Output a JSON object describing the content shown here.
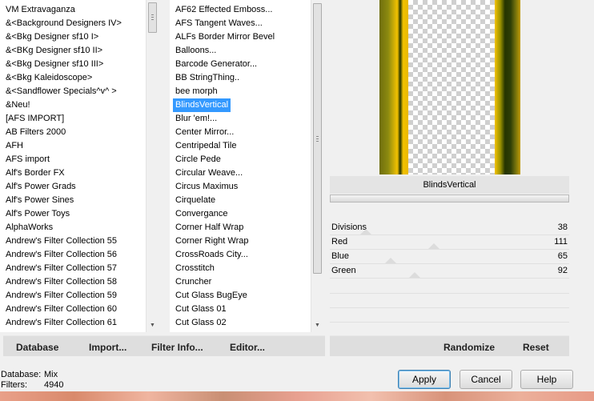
{
  "categories": {
    "items": [
      "VM Extravaganza",
      "&<Background Designers IV>",
      "&<Bkg Designer sf10 I>",
      "&<BKg Designer sf10 II>",
      "&<Bkg Designer sf10 III>",
      "&<Bkg Kaleidoscope>",
      "&<Sandflower Specials^v^ >",
      "&Neu!",
      "[AFS IMPORT]",
      "AB Filters 2000",
      "AFH",
      "AFS import",
      "Alf's Border FX",
      "Alf's Power Grads",
      "Alf's Power Sines",
      "Alf's Power Toys",
      "AlphaWorks",
      "Andrew's Filter Collection 55",
      "Andrew's Filter Collection 56",
      "Andrew's Filter Collection 57",
      "Andrew's Filter Collection 58",
      "Andrew's Filter Collection 59",
      "Andrew's Filter Collection 60",
      "Andrew's Filter Collection 61"
    ]
  },
  "filters": {
    "selected_index": 7,
    "items": [
      "AF62 Effected Emboss...",
      "AFS Tangent Waves...",
      "ALFs Border Mirror Bevel",
      "Balloons...",
      "Barcode Generator...",
      "BB StringThing..",
      "bee morph",
      "BlindsVertical",
      "Blur 'em!...",
      "Center Mirror...",
      "Centripedal Tile",
      "Circle Pede",
      "Circular Weave...",
      "Circus Maximus",
      "Cirquelate",
      "Convergance",
      "Corner Half Wrap",
      "Corner Right Wrap",
      "CrossRoads City...",
      "Crosstitch",
      "Cruncher",
      "Cut Glass  BugEye",
      "Cut Glass 01",
      "Cut Glass 02"
    ]
  },
  "preview": {
    "filter_name": "BlindsVertical",
    "stripe_colors": [
      "#6f6e0d",
      "#f3c200",
      "#253400"
    ]
  },
  "sliders": [
    {
      "label": "Divisions",
      "value": "38",
      "level": 38
    },
    {
      "label": "Red",
      "value": "111",
      "level": 111
    },
    {
      "label": "Blue",
      "value": "65",
      "level": 65
    },
    {
      "label": "Green",
      "value": "92",
      "level": 92
    }
  ],
  "toolbar_left": {
    "database": "Database",
    "import": "Import...",
    "filter_info": "Filter Info...",
    "editor": "Editor..."
  },
  "toolbar_right": {
    "randomize": "Randomize",
    "reset": "Reset"
  },
  "status": {
    "database_label": "Database:",
    "database_value": "Mix",
    "filters_label": "Filters:",
    "filters_value": "4940"
  },
  "buttons": {
    "apply": "Apply",
    "cancel": "Cancel",
    "help": "Help"
  }
}
